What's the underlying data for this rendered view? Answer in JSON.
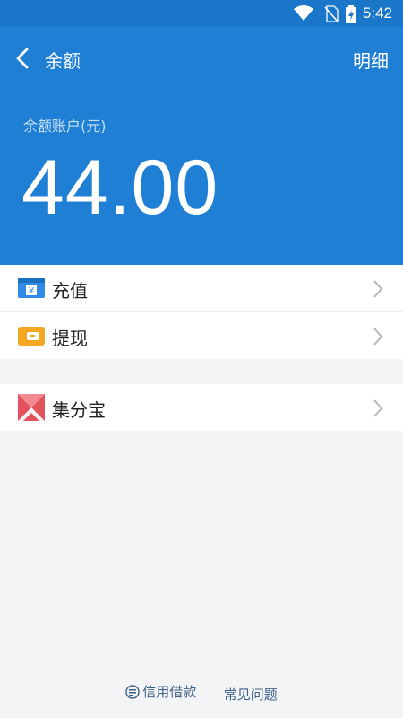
{
  "status_bar": {
    "time": "5:42",
    "icons": [
      "wifi-icon",
      "no-sim-icon",
      "battery-charging-icon"
    ]
  },
  "header": {
    "title": "余额",
    "detail_label": "明细",
    "balance_label": "余额账户(元)",
    "balance_amount": "44.00",
    "accent_color": "#1e7fd4"
  },
  "list": {
    "group1": [
      {
        "label": "充值",
        "icon": "recharge-yen-icon"
      },
      {
        "label": "提现",
        "icon": "withdraw-wallet-icon"
      }
    ],
    "group2": [
      {
        "label": "集分宝",
        "icon": "jifenbao-icon"
      }
    ]
  },
  "footer": {
    "credit_loan": "信用借款",
    "faq": "常见问题"
  }
}
